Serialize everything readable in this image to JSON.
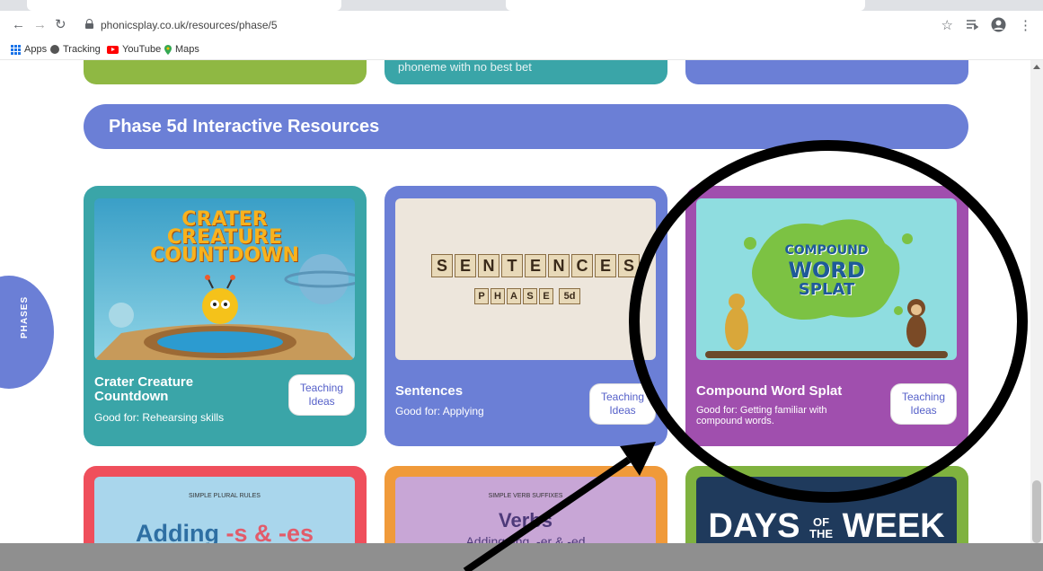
{
  "browser": {
    "url": "phonicsplay.co.uk/resources/phase/5",
    "bookmarks": [
      {
        "label": "Apps",
        "icon": "apps-grid-icon"
      },
      {
        "label": "Tracking",
        "icon": "globe-icon"
      },
      {
        "label": "YouTube",
        "icon": "youtube-icon"
      },
      {
        "label": "Maps",
        "icon": "maps-pin-icon"
      }
    ],
    "icons": {
      "back": "←",
      "forward": "→",
      "reload": "↻",
      "star": "☆",
      "menu": "⋮"
    }
  },
  "previous_cards": [
    {
      "text": ""
    },
    {
      "text": "phoneme with no best bet"
    },
    {
      "text": ""
    }
  ],
  "section": {
    "title": "Phase 5d Interactive Resources"
  },
  "phases_tab": {
    "label": "PHASES"
  },
  "cards": [
    {
      "title_line1": "Crater Creature",
      "title_line2": "Countdown",
      "good_for": "Good for: Rehearsing skills",
      "teaching_line1": "Teaching",
      "teaching_line2": "Ideas",
      "art": {
        "line1": "CRATER",
        "line2": "CREATURE",
        "line3": "COUNTDOWN"
      },
      "color": "#3aa5a8"
    },
    {
      "title_line1": "Sentences",
      "title_line2": "",
      "good_for": "Good for: Applying",
      "teaching_line1": "Teaching",
      "teaching_line2": "Ideas",
      "art": {
        "tiles": [
          "S",
          "E",
          "N",
          "T",
          "E",
          "N",
          "C",
          "E",
          "S"
        ],
        "sub_tiles": [
          "P",
          "H",
          "A",
          "S",
          "E",
          "5d"
        ]
      },
      "color": "#6b7fd6"
    },
    {
      "title_line1": "Compound Word Splat",
      "title_line2": "",
      "good_for_line1": "Good for: Getting familiar with",
      "good_for_line2": "compound words.",
      "teaching_line1": "Teaching",
      "teaching_line2": "Ideas",
      "art": {
        "line1": "COMPOUND",
        "line2": "WORD",
        "line3": "SPLAT"
      },
      "color": "#a04fae"
    }
  ],
  "row2": [
    {
      "kicker": "SIMPLE PLURAL RULES",
      "heading_a": "Adding ",
      "heading_b": "-s & -es",
      "color": "#ef4f5c"
    },
    {
      "kicker": "SIMPLE VERB SUFFIXES",
      "heading": "Verbs",
      "sub": "Adding -ing, -er & -ed",
      "color": "#f09a3a"
    },
    {
      "heading_a": "DAYS ",
      "heading_b": "OF",
      "heading_c": "THE",
      "heading_d": " WEEK",
      "color": "#7fb23f"
    }
  ]
}
